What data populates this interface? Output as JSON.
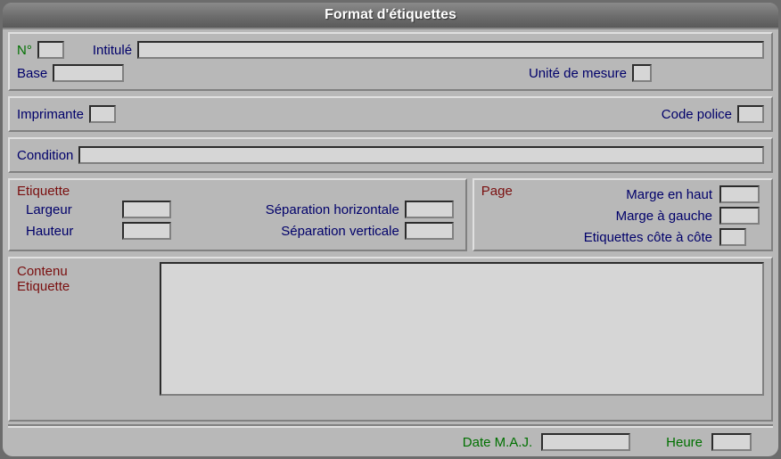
{
  "title": "Format d'étiquettes",
  "header": {
    "numero_label": "N°",
    "numero_value": "",
    "intitule_label": "Intitulé",
    "intitule_value": "",
    "base_label": "Base",
    "base_value": "",
    "unite_label": "Unité de mesure",
    "unite_value": ""
  },
  "printer": {
    "imprimante_label": "Imprimante",
    "imprimante_value": "",
    "code_police_label": "Code police",
    "code_police_value": ""
  },
  "condition": {
    "label": "Condition",
    "value": ""
  },
  "etiquette": {
    "section": "Etiquette",
    "largeur_label": "Largeur",
    "largeur_value": "",
    "hauteur_label": "Hauteur",
    "hauteur_value": "",
    "sep_h_label": "Séparation horizontale",
    "sep_h_value": "",
    "sep_v_label": "Séparation verticale",
    "sep_v_value": ""
  },
  "page": {
    "section": "Page",
    "marge_haut_label": "Marge en haut",
    "marge_haut_value": "",
    "marge_gauche_label": "Marge à gauche",
    "marge_gauche_value": "",
    "cote_label": "Etiquettes côte à côte",
    "cote_value": ""
  },
  "contenu": {
    "label1": "Contenu",
    "label2": "Etiquette",
    "value": ""
  },
  "footer": {
    "date_label": "Date M.A.J.",
    "date_value": "",
    "heure_label": "Heure",
    "heure_value": ""
  }
}
